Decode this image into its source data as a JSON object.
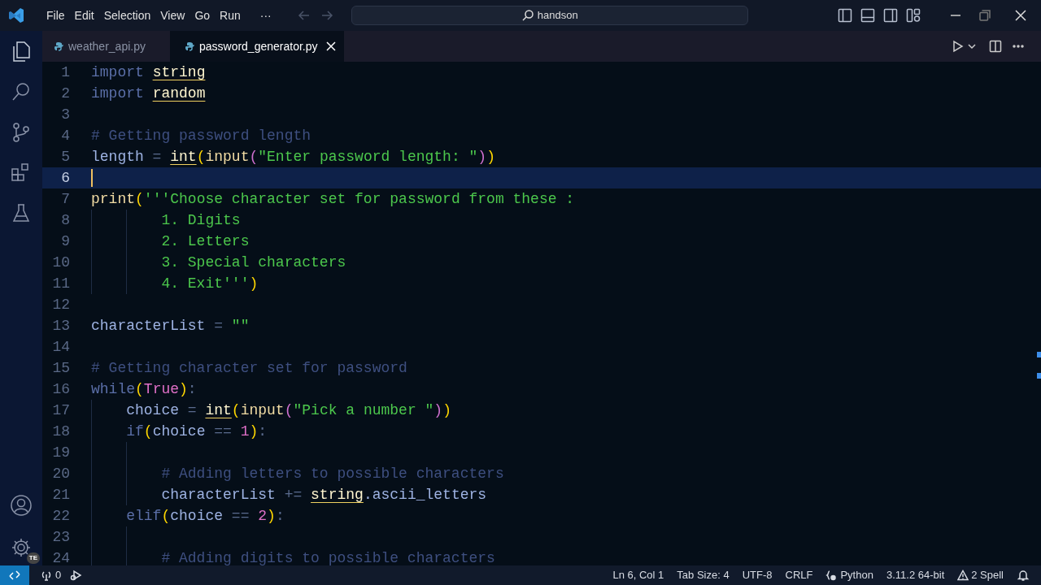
{
  "title_bar": {
    "menu": [
      "File",
      "Edit",
      "Selection",
      "View",
      "Go",
      "Run"
    ],
    "more": "···",
    "search": "handson"
  },
  "editor_tabs": [
    {
      "label": "weather_api.py",
      "selected": false
    },
    {
      "label": "password_generator.py",
      "selected": true
    }
  ],
  "code": [
    {
      "number": "1",
      "current": false,
      "tokens": [
        {
          "text": "import ",
          "kind": "kw"
        },
        {
          "text": "string",
          "kind": "mod"
        }
      ]
    },
    {
      "number": "2",
      "current": false,
      "tokens": [
        {
          "text": "import ",
          "kind": "kw"
        },
        {
          "text": "random",
          "kind": "mod"
        }
      ]
    },
    {
      "number": "3",
      "current": false
    },
    {
      "number": "4",
      "current": false,
      "tokens": [
        {
          "text": "# Getting password length",
          "kind": "comment"
        }
      ]
    },
    {
      "number": "5",
      "current": false,
      "tokens": [
        {
          "text": "length",
          "kind": "var"
        },
        {
          "text": " = ",
          "kind": "op"
        },
        {
          "text": "int",
          "kind": "mod"
        },
        {
          "text": "(",
          "kind": "p1"
        },
        {
          "text": "input",
          "kind": "fn"
        },
        {
          "text": "(",
          "kind": "p2"
        },
        {
          "text": "\"Enter password length: \"",
          "kind": "str"
        },
        {
          "text": ")",
          "kind": "p2"
        },
        {
          "text": ")",
          "kind": "p1"
        }
      ]
    },
    {
      "number": "6",
      "current": true
    },
    {
      "number": "7",
      "current": false,
      "tokens": [
        {
          "text": "print",
          "kind": "fn"
        },
        {
          "text": "(",
          "kind": "p1"
        },
        {
          "text": "'''Choose character set for password from these :",
          "kind": "str"
        }
      ]
    },
    {
      "number": "8",
      "current": false,
      "tokens": [
        {
          "text": "        1. Digits",
          "kind": "str"
        }
      ]
    },
    {
      "number": "9",
      "current": false,
      "tokens": [
        {
          "text": "        2. Letters",
          "kind": "str"
        }
      ]
    },
    {
      "number": "10",
      "current": false,
      "tokens": [
        {
          "text": "        3. Special characters",
          "kind": "str"
        }
      ]
    },
    {
      "number": "11",
      "current": false,
      "tokens": [
        {
          "text": "        4. Exit'''",
          "kind": "str"
        },
        {
          "text": ")",
          "kind": "p1"
        }
      ]
    },
    {
      "number": "12",
      "current": false
    },
    {
      "number": "13",
      "current": false,
      "tokens": [
        {
          "text": "characterList",
          "kind": "var"
        },
        {
          "text": " = ",
          "kind": "op"
        },
        {
          "text": "\"\"",
          "kind": "str"
        }
      ]
    },
    {
      "number": "14",
      "current": false
    },
    {
      "number": "15",
      "current": false,
      "tokens": [
        {
          "text": "# Getting character set for password",
          "kind": "comment"
        }
      ]
    },
    {
      "number": "16",
      "current": false,
      "tokens": [
        {
          "text": "while",
          "kind": "kw"
        },
        {
          "text": "(",
          "kind": "p1"
        },
        {
          "text": "True",
          "kind": "num"
        },
        {
          "text": ")",
          "kind": "p1"
        },
        {
          "text": ":",
          "kind": "op"
        }
      ]
    },
    {
      "number": "17",
      "current": false,
      "tokens": [
        {
          "text": "    choice",
          "kind": "var"
        },
        {
          "text": " = ",
          "kind": "op"
        },
        {
          "text": "int",
          "kind": "mod"
        },
        {
          "text": "(",
          "kind": "p1"
        },
        {
          "text": "input",
          "kind": "fn"
        },
        {
          "text": "(",
          "kind": "p2"
        },
        {
          "text": "\"Pick a number \"",
          "kind": "str"
        },
        {
          "text": ")",
          "kind": "p2"
        },
        {
          "text": ")",
          "kind": "p1"
        }
      ]
    },
    {
      "number": "18",
      "current": false,
      "tokens": [
        {
          "text": "    if",
          "kind": "kw"
        },
        {
          "text": "(",
          "kind": "p1"
        },
        {
          "text": "choice",
          "kind": "var"
        },
        {
          "text": " == ",
          "kind": "op"
        },
        {
          "text": "1",
          "kind": "num"
        },
        {
          "text": ")",
          "kind": "p1"
        },
        {
          "text": ":",
          "kind": "op"
        }
      ]
    },
    {
      "number": "19",
      "current": false
    },
    {
      "number": "20",
      "current": false,
      "tokens": [
        {
          "text": "        # Adding letters to possible characters",
          "kind": "comment"
        }
      ]
    },
    {
      "number": "21",
      "current": false,
      "tokens": [
        {
          "text": "        characterList",
          "kind": "var"
        },
        {
          "text": " += ",
          "kind": "op"
        },
        {
          "text": "string",
          "kind": "mod"
        },
        {
          "text": ".ascii_letters",
          "kind": "var"
        }
      ]
    },
    {
      "number": "22",
      "current": false,
      "tokens": [
        {
          "text": "    elif",
          "kind": "kw"
        },
        {
          "text": "(",
          "kind": "p1"
        },
        {
          "text": "choice",
          "kind": "var"
        },
        {
          "text": " == ",
          "kind": "op"
        },
        {
          "text": "2",
          "kind": "num"
        },
        {
          "text": ")",
          "kind": "p1"
        },
        {
          "text": ":",
          "kind": "op"
        }
      ]
    },
    {
      "number": "23",
      "current": false
    },
    {
      "number": "24",
      "current": false,
      "tokens": [
        {
          "text": "        # Adding digits to possible characters",
          "kind": "comment"
        }
      ]
    }
  ],
  "activity_bar": {
    "account_badge": "TE"
  },
  "status_bar": {
    "ports": "0",
    "items": [
      "Ln 6, Col 1",
      "Tab Size: 4",
      "UTF-8",
      "CRLF"
    ],
    "language": "Python",
    "interpreter": "3.11.2 64-bit",
    "problems": "2 Spell"
  }
}
